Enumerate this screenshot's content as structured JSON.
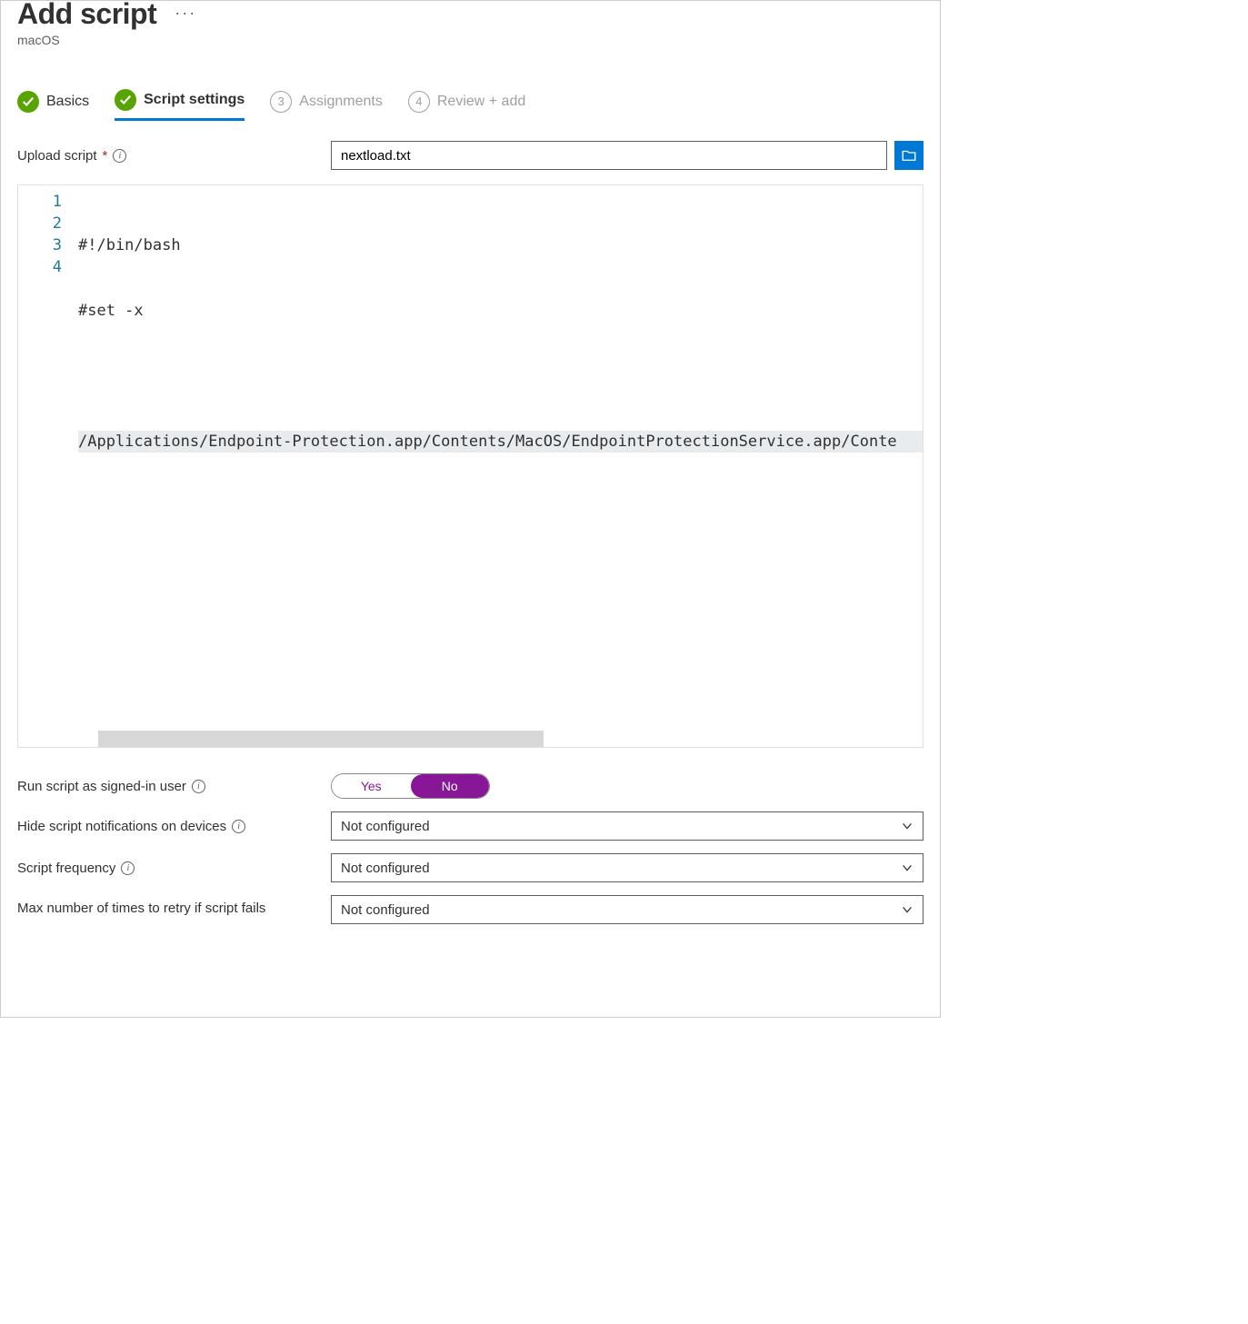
{
  "header": {
    "title": "Add script",
    "subtitle": "macOS"
  },
  "steps": [
    {
      "label": "Basics",
      "state": "done"
    },
    {
      "label": "Script settings",
      "state": "active"
    },
    {
      "label": "Assignments",
      "state": "pending",
      "num": "3"
    },
    {
      "label": "Review + add",
      "state": "pending",
      "num": "4"
    }
  ],
  "upload": {
    "label": "Upload script",
    "filename": "nextload.txt"
  },
  "code": {
    "line_numbers": [
      "1",
      "2",
      "3",
      "4"
    ],
    "lines": [
      "#!/bin/bash",
      "#set -x",
      "",
      "/Applications/Endpoint-Protection.app/Contents/MacOS/EndpointProtectionService.app/Conte"
    ],
    "highlight_index": 3
  },
  "settings": {
    "run_as_user": {
      "label": "Run script as signed-in user",
      "yes": "Yes",
      "no": "No",
      "value": "No"
    },
    "hide_notifications": {
      "label": "Hide script notifications on devices",
      "value": "Not configured"
    },
    "frequency": {
      "label": "Script frequency",
      "value": "Not configured"
    },
    "retry": {
      "label": "Max number of times to retry if script fails",
      "value": "Not configured"
    }
  }
}
